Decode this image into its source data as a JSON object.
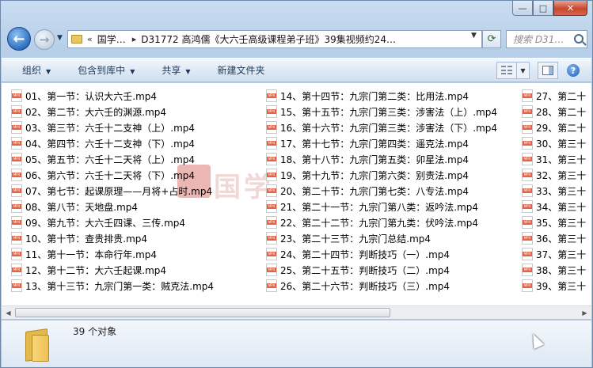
{
  "window": {
    "minimize_glyph": "—",
    "maximize_glyph": "□",
    "close_glyph": "✕"
  },
  "nav": {
    "back_glyph": "←",
    "forward_glyph": "→",
    "address_chevron": "«",
    "address_segment": "国学…",
    "address_path": "D31772 高鸿儒《大六壬高级课程弟子班》39集视频约24…",
    "search_placeholder": "搜索 D31…"
  },
  "toolbar": {
    "organize": "组织",
    "include_in_library": "包含到库中",
    "share": "共享",
    "new_folder": "新建文件夹",
    "help_glyph": "?"
  },
  "files": {
    "col1": [
      "01、第一节：认识大六壬.mp4",
      "02、第二节：大六壬的渊源.mp4",
      "03、第三节：六壬十二支神（上）.mp4",
      "04、第四节：六壬十二支神（下）.mp4",
      "05、第五节：六壬十二天将（上）.mp4",
      "06、第六节：六壬十二天将（下）.mp4",
      "07、第七节：起课原理——月将+占时.mp4",
      "08、第八节：天地盘.mp4",
      "09、第九节：大六壬四课、三传.mp4",
      "10、第十节：查贵排贵.mp4",
      "11、第十一节：本命行年.mp4",
      "12、第十二节：大六壬起课.mp4",
      "13、第十三节：九宗门第一类：贼克法.mp4"
    ],
    "col2": [
      "14、第十四节：九宗门第二类：比用法.mp4",
      "15、第十五节：九宗门第三类：涉害法（上）.mp4",
      "16、第十六节：九宗门第三类：涉害法（下）.mp4",
      "17、第十七节：九宗门第四类：遥克法.mp4",
      "18、第十八节：九宗门第五类：卯星法.mp4",
      "19、第十九节：九宗门第六类：别责法.mp4",
      "20、第二十节：九宗门第七类：八专法.mp4",
      "21、第二十一节：九宗门第八类：返吟法.mp4",
      "22、第二十二节：九宗门第九类：伏吟法.mp4",
      "23、第二十三节：九宗门总结.mp4",
      "24、第二十四节：判断技巧（一）.mp4",
      "25、第二十五节：判断技巧（二）.mp4",
      "26、第二十六节：判断技巧（三）.mp4"
    ],
    "col3": [
      "27、第二十",
      "28、第二十",
      "29、第二十",
      "30、第三十",
      "31、第三十",
      "32、第三十",
      "33、第三十",
      "34、第三十",
      "35、第三十",
      "36、第三十",
      "37、第三十",
      "38、第三十",
      "39、第三十"
    ]
  },
  "watermark": "国学",
  "details": {
    "count": "39 个对象"
  }
}
